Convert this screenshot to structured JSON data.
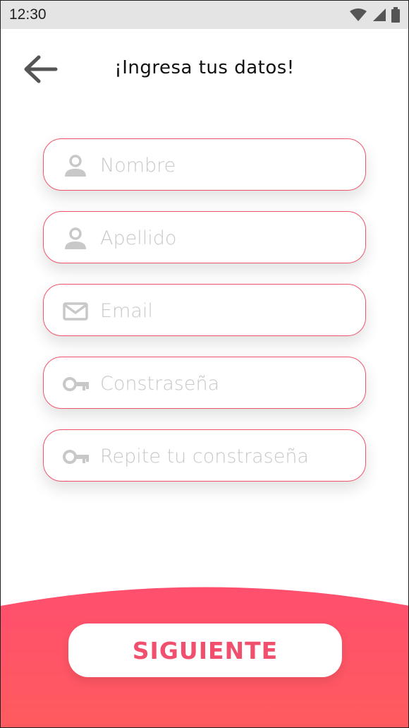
{
  "status_bar": {
    "time": "12:30",
    "icons": [
      "wifi-icon",
      "signal-icon",
      "battery-icon"
    ]
  },
  "header": {
    "title": "¡Ingresa tus datos!",
    "back_icon": "arrow-left-icon"
  },
  "form": {
    "fields": [
      {
        "placeholder": "Nombre",
        "icon": "user-icon"
      },
      {
        "placeholder": "Apellido",
        "icon": "user-icon"
      },
      {
        "placeholder": "Email",
        "icon": "mail-icon"
      },
      {
        "placeholder": "Constraseña",
        "icon": "key-icon"
      },
      {
        "placeholder": "Repite tu constraseña",
        "icon": "key-icon"
      }
    ]
  },
  "footer": {
    "next_label": "SIGUIENTE"
  },
  "colors": {
    "accent": "#f0546d",
    "gradient_top": "#ff4f6e",
    "gradient_bottom": "#ff5b5e",
    "placeholder": "#c8c8c8",
    "icon": "#c8c8c8"
  }
}
